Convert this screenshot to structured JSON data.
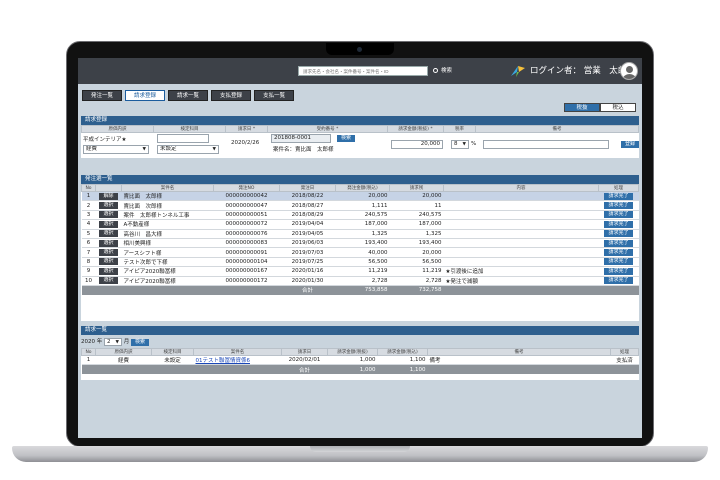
{
  "header": {
    "search_placeholder": "請求先名・会社名・案件番号・案件名・ID",
    "search_button": "検索",
    "login_label": "ログイン者：",
    "user_name": "営業　太郎"
  },
  "nav": {
    "tabs": [
      "発注一覧",
      "請求登録",
      "請求一覧",
      "支払登録",
      "支払一覧"
    ],
    "active": "請求登録"
  },
  "tax_toggle": {
    "on": "税抜",
    "off": "税込"
  },
  "register": {
    "title": "請求登録",
    "columns": [
      "原価内訳",
      "検定科目",
      "請求日 *",
      "受約番号 *",
      "請求金額(税抜) *",
      "税率",
      "備考"
    ],
    "client": "平成インテリア★",
    "cost_select": "経費",
    "account_select": "未設定",
    "billing_date": "2020/2/26",
    "contract_no": "201808-0001",
    "search_button": "検索",
    "project_label": "案件名：賣比面　太郎様",
    "amount": "20,000",
    "tax_rate": "8",
    "tax_unit": "%",
    "register_button": "登録"
  },
  "orders": {
    "title": "発注選一覧",
    "columns": [
      "No",
      "",
      "案件名",
      "発注NO",
      "発注日",
      "発注金額(税込)",
      "請求残",
      "内容",
      "処理"
    ],
    "rows": [
      [
        "1",
        "解除",
        "賣比面　太郎様",
        "000000000042",
        "2018/08/22",
        "20,000",
        "20,000",
        "",
        "請求完了"
      ],
      [
        "2",
        "選択",
        "賣比面　次郎様",
        "000000000047",
        "2018/08/27",
        "1,111",
        "11",
        "",
        "請求完了"
      ],
      [
        "3",
        "選択",
        "案件　太郎様トンネル工事",
        "000000000051",
        "2018/08/29",
        "240,575",
        "240,575",
        "",
        "請求完了"
      ],
      [
        "4",
        "選択",
        "A不動産様",
        "000000000072",
        "2019/04/04",
        "187,000",
        "187,000",
        "",
        "請求完了"
      ],
      [
        "5",
        "選択",
        "高谷川　昌大様",
        "000000000076",
        "2019/04/05",
        "1,325",
        "1,325",
        "",
        "請求完了"
      ],
      [
        "6",
        "選択",
        "相川美興様",
        "000000000083",
        "2019/06/03",
        "193,400",
        "193,400",
        "",
        "請求完了"
      ],
      [
        "7",
        "選択",
        "アースシフト様",
        "000000000091",
        "2019/07/03",
        "40,000",
        "20,000",
        "",
        "請求完了"
      ],
      [
        "8",
        "選択",
        "テスト次郎で下様",
        "000000000104",
        "2019/07/25",
        "56,500",
        "56,500",
        "",
        "請求完了"
      ],
      [
        "9",
        "選択",
        "アイピア2020聯冨様",
        "000000000167",
        "2020/01/16",
        "11,219",
        "11,219",
        "★引渡後に追加",
        "請求完了"
      ],
      [
        "10",
        "選択",
        "アイピア2020聯冨様",
        "000000000172",
        "2020/01/30",
        "2,728",
        "2,728",
        "★発注で減額",
        "請求完了"
      ]
    ],
    "total_label": "合計",
    "total_amount": "753,858",
    "total_remaining": "732,758"
  },
  "billing": {
    "title": "請求一覧",
    "year": "2020",
    "year_label": "年",
    "month": "2",
    "month_label": "月",
    "search_button": "検索",
    "columns": [
      "No",
      "原価内訳",
      "検定科目",
      "案件名",
      "請求日",
      "請求金額(税抜)",
      "請求金額(税込)",
      "備考",
      "処理"
    ],
    "rows": [
      [
        "1",
        "経費",
        "未設定",
        "01テスト聯冨情資係6",
        "2020/02/01",
        "1,000",
        "1,100",
        "備考",
        "支払済"
      ]
    ],
    "total_label": "合計",
    "total_excl": "1,000",
    "total_incl": "1,100"
  }
}
